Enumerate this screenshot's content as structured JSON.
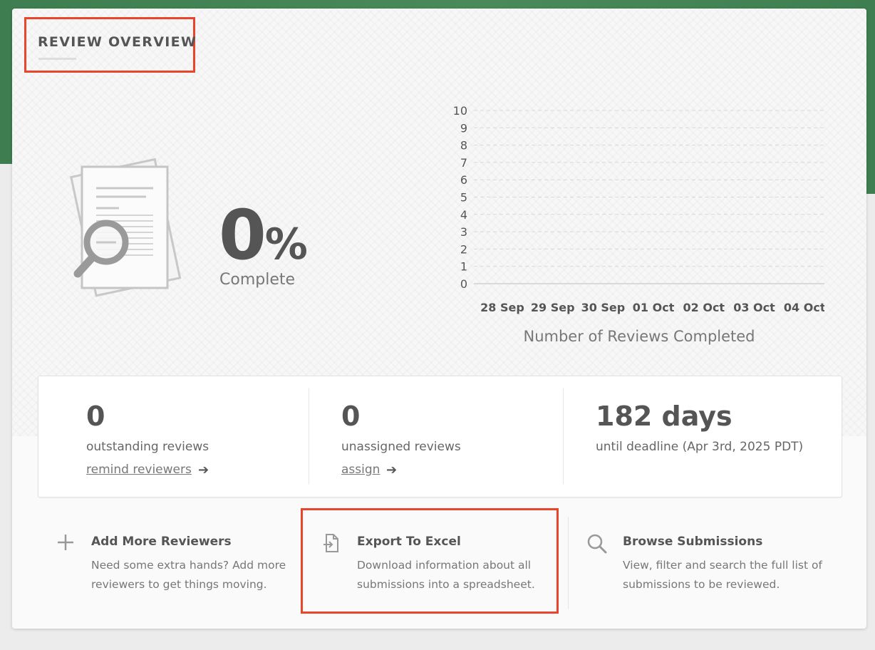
{
  "header": {
    "title": "REVIEW OVERVIEW"
  },
  "progress": {
    "percent_value": "0",
    "percent_sign": "%",
    "label": "Complete"
  },
  "chart_data": {
    "type": "line",
    "categories": [
      "28 Sep",
      "29 Sep",
      "30 Sep",
      "01 Oct",
      "02 Oct",
      "03 Oct",
      "04 Oct"
    ],
    "series": [
      {
        "values": [
          0,
          0,
          0,
          0,
          0,
          0,
          0
        ]
      }
    ],
    "y_ticks": [
      "0",
      "1",
      "2",
      "3",
      "4",
      "5",
      "6",
      "7",
      "8",
      "9",
      "10"
    ],
    "ylim": [
      0,
      10
    ],
    "xlabel": "Number of Reviews Completed",
    "ylabel": "",
    "grid": true
  },
  "stats": {
    "outstanding": {
      "value": "0",
      "label": "outstanding reviews",
      "link": "remind reviewers",
      "arrow": "➔"
    },
    "unassigned": {
      "value": "0",
      "label": "unassigned reviews",
      "link": "assign",
      "arrow": "➔"
    },
    "deadline": {
      "value": "182 days",
      "label": "until deadline (Apr 3rd, 2025 PDT)"
    }
  },
  "actions": {
    "add": {
      "title": "Add More Reviewers",
      "line1": "Need some extra hands? Add more",
      "line2": "reviewers to get things moving.",
      "icon": "plus-icon"
    },
    "export": {
      "title": "Export To Excel",
      "line1": "Download information about all",
      "line2": "submissions into a spreadsheet.",
      "icon": "export-file-icon"
    },
    "browse": {
      "title": "Browse Submissions",
      "line1": "View, filter and search the full list of",
      "line2": "submissions to be reviewed.",
      "icon": "search-icon"
    }
  },
  "colors": {
    "highlight": "#e8452c",
    "brand_green": "#3f7e50"
  }
}
